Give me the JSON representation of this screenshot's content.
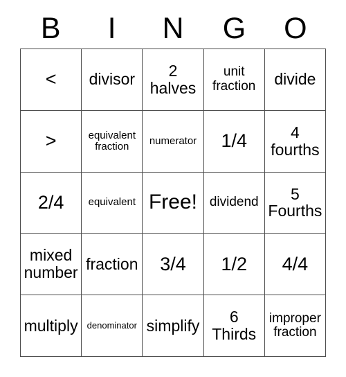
{
  "card": {
    "header_letters": [
      "B",
      "I",
      "N",
      "G",
      "O"
    ],
    "rows": [
      [
        {
          "text": "<",
          "size": "lg"
        },
        {
          "text": "divisor",
          "size": "md"
        },
        {
          "text": "2\nhalves",
          "size": "md"
        },
        {
          "text": "unit\nfraction",
          "size": "sm"
        },
        {
          "text": "divide",
          "size": "md"
        }
      ],
      [
        {
          "text": ">",
          "size": "lg"
        },
        {
          "text": "equivalent\nfraction",
          "size": "xs"
        },
        {
          "text": "numerator",
          "size": "xs"
        },
        {
          "text": "1/4",
          "size": "lg"
        },
        {
          "text": "4\nfourths",
          "size": "md"
        }
      ],
      [
        {
          "text": "2/4",
          "size": "lg"
        },
        {
          "text": "equivalent",
          "size": "xs"
        },
        {
          "text": "Free!",
          "size": "xl"
        },
        {
          "text": "dividend",
          "size": "sm"
        },
        {
          "text": "5\nFourths",
          "size": "md"
        }
      ],
      [
        {
          "text": "mixed\nnumber",
          "size": "md"
        },
        {
          "text": "fraction",
          "size": "md"
        },
        {
          "text": "3/4",
          "size": "lg"
        },
        {
          "text": "1/2",
          "size": "lg"
        },
        {
          "text": "4/4",
          "size": "lg"
        }
      ],
      [
        {
          "text": "multiply",
          "size": "md"
        },
        {
          "text": "denominator",
          "size": "xxs"
        },
        {
          "text": "simplify",
          "size": "md"
        },
        {
          "text": "6\nThirds",
          "size": "md"
        },
        {
          "text": "improper\nfraction",
          "size": "sm"
        }
      ]
    ],
    "colors": {
      "border": "#4d4d4d",
      "text": "#000000",
      "background": "#ffffff"
    }
  }
}
